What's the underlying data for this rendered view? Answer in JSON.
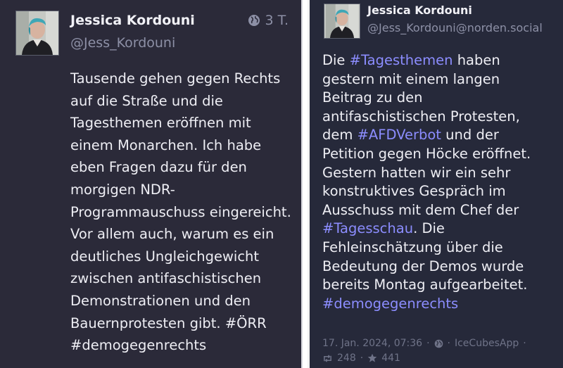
{
  "left_post": {
    "author_name": "Jessica Kordouni",
    "author_handle": "@Jess_Kordouni",
    "time_ago": "3 T.",
    "lines": [
      {
        "parts": [
          {
            "text": "Tausende gehen gegen Rechts"
          }
        ]
      },
      {
        "parts": [
          {
            "text": "auf die Straße und die"
          }
        ]
      },
      {
        "parts": [
          {
            "text": "Tagesthemen eröffnen mit"
          }
        ]
      },
      {
        "parts": [
          {
            "text": "einem Monarchen. Ich habe"
          }
        ]
      },
      {
        "parts": [
          {
            "text": "eben Fragen dazu für den"
          }
        ]
      },
      {
        "parts": [
          {
            "text": "morgigen NDR-"
          }
        ]
      },
      {
        "parts": [
          {
            "text": "Programmauschuss eingereicht."
          }
        ]
      },
      {
        "parts": [
          {
            "text": "Vor allem auch, warum es ein"
          }
        ]
      },
      {
        "parts": [
          {
            "text": "deutliches Ungleichgewicht"
          }
        ]
      },
      {
        "parts": [
          {
            "text": "zwischen antifaschistischen"
          }
        ]
      },
      {
        "parts": [
          {
            "text": "Demonstrationen und den"
          }
        ]
      },
      {
        "parts": [
          {
            "text": "Bauernprotesten gibt. #ÖRR"
          }
        ]
      },
      {
        "parts": [
          {
            "text": "#demogegenrechts"
          }
        ]
      }
    ]
  },
  "right_post": {
    "author_name": "Jessica Kordouni",
    "author_handle": "@Jess_Kordouni@norden.social",
    "lines": [
      {
        "parts": [
          {
            "text": "Die "
          },
          {
            "text": "#Tagesthemen",
            "tag": true
          },
          {
            "text": " haben"
          }
        ]
      },
      {
        "parts": [
          {
            "text": "gestern mit einem langen"
          }
        ]
      },
      {
        "parts": [
          {
            "text": "Beitrag zu den"
          }
        ]
      },
      {
        "parts": [
          {
            "text": "antifaschistischen Protesten,"
          }
        ]
      },
      {
        "parts": [
          {
            "text": "dem "
          },
          {
            "text": "#AFDVerbot",
            "tag": true
          },
          {
            "text": " und der"
          }
        ]
      },
      {
        "parts": [
          {
            "text": "Petition gegen Höcke eröffnet."
          }
        ]
      },
      {
        "parts": [
          {
            "text": "Gestern hatten wir ein sehr"
          }
        ]
      },
      {
        "parts": [
          {
            "text": "konstruktives Gespräch im"
          }
        ]
      },
      {
        "parts": [
          {
            "text": "Ausschuss mit dem Chef der"
          }
        ]
      },
      {
        "parts": [
          {
            "text": "#Tagesschau",
            "tag": true
          },
          {
            "text": ". Die"
          }
        ]
      },
      {
        "parts": [
          {
            "text": "Fehleinschätzung über die"
          }
        ]
      },
      {
        "parts": [
          {
            "text": "Bedeutung der Demos wurde"
          }
        ]
      },
      {
        "parts": [
          {
            "text": "bereits Montag aufgearbeitet."
          }
        ]
      },
      {
        "parts": [
          {
            "text": "#demogegenrechts",
            "tag": true
          }
        ]
      }
    ],
    "date": "17. Jan. 2024, 07:36",
    "separator": "·",
    "app": "IceCubesApp",
    "boosts": "248",
    "favourites": "441"
  },
  "colors": {
    "left_bg": "#2b2a39",
    "right_bg": "#26293a",
    "hashtag": "#8c8dff",
    "muted": "#8d90a6"
  },
  "icons": {
    "visibility": "globe-icon",
    "boost": "boost-icon",
    "favourite": "star-icon"
  }
}
